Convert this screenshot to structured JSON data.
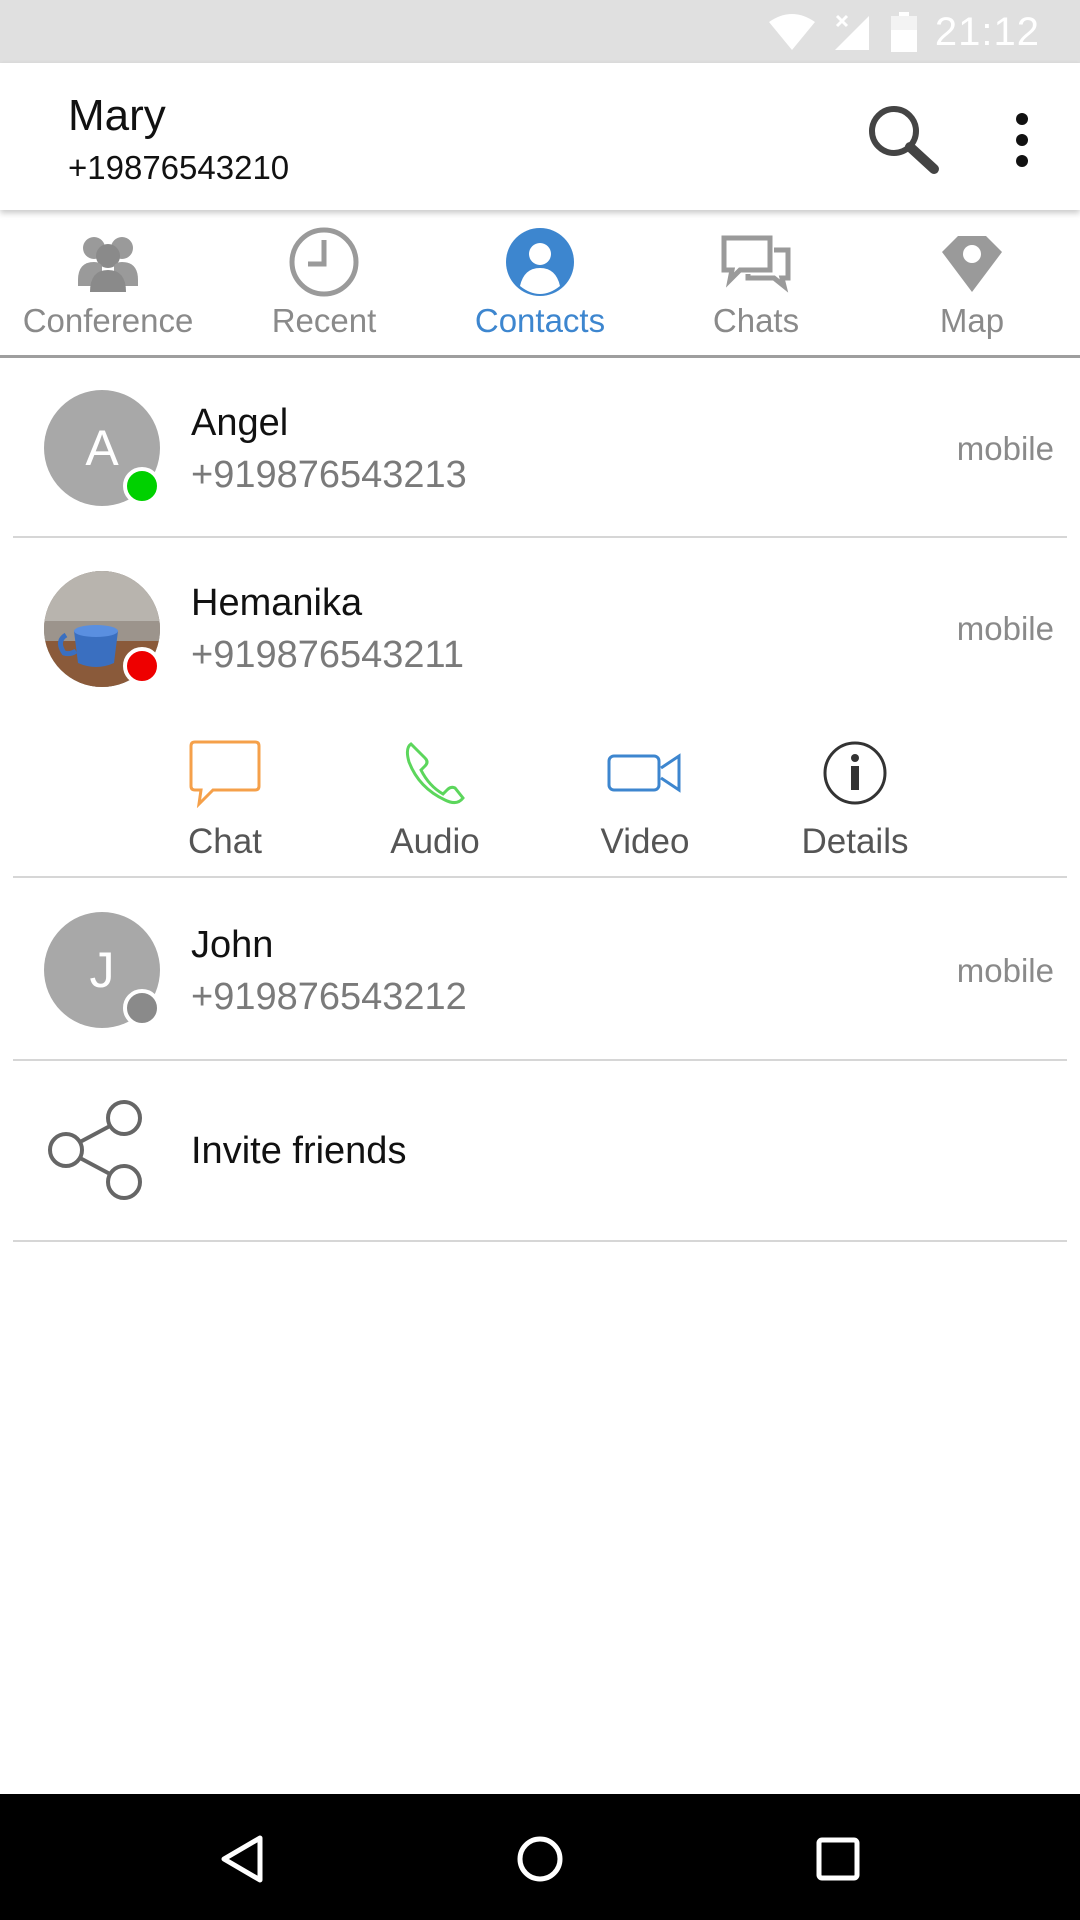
{
  "status_bar": {
    "time": "21:12",
    "icons": [
      "wifi-icon",
      "signal-off-icon",
      "battery-icon"
    ]
  },
  "header": {
    "name": "Mary",
    "phone": "+19876543210"
  },
  "tabs": [
    {
      "label": "Conference",
      "icon": "conference-icon",
      "active": false
    },
    {
      "label": "Recent",
      "icon": "clock-icon",
      "active": false
    },
    {
      "label": "Contacts",
      "icon": "contact-icon",
      "active": true
    },
    {
      "label": "Chats",
      "icon": "chats-icon",
      "active": false
    },
    {
      "label": "Map",
      "icon": "map-pin-icon",
      "active": false
    }
  ],
  "contacts": [
    {
      "initial": "A",
      "name": "Angel",
      "phone": "+919876543213",
      "type": "mobile",
      "status_color": "#00d100"
    },
    {
      "initial": "",
      "name": "Hemanika",
      "phone": "+919876543211",
      "type": "mobile",
      "status_color": "#ee0000"
    },
    {
      "initial": "J",
      "name": "John",
      "phone": "+919876543212",
      "type": "mobile",
      "status_color": "#8a8a8a"
    }
  ],
  "actions": [
    {
      "label": "Chat",
      "icon": "chat-bubble-icon",
      "color": "#f5a04a"
    },
    {
      "label": "Audio",
      "icon": "phone-icon",
      "color": "#5cd65c"
    },
    {
      "label": "Video",
      "icon": "video-camera-icon",
      "color": "#3d86cf"
    },
    {
      "label": "Details",
      "icon": "info-icon",
      "color": "#333333"
    }
  ],
  "invite": {
    "label": "Invite friends",
    "icon": "share-icon"
  },
  "colors": {
    "accent": "#3d86cf",
    "tab_inactive": "#8a8a8a"
  }
}
